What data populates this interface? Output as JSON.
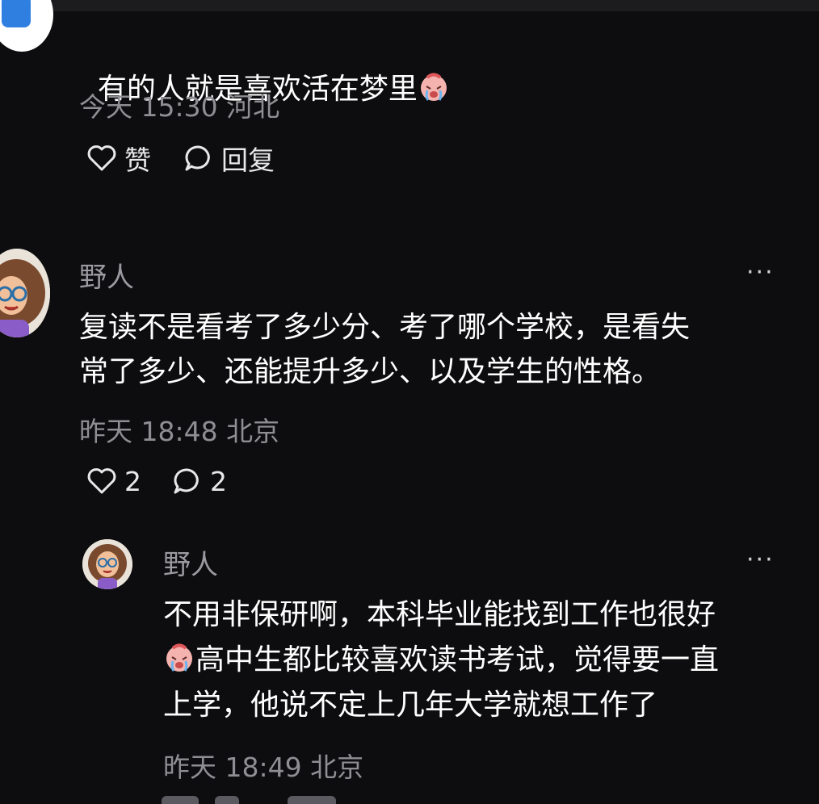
{
  "comment1": {
    "text": "有的人就是喜欢活在梦里",
    "emoji": "crying-face-emoji",
    "time_location": "今天 15:30 河北",
    "like_label": "赞",
    "reply_label": "回复"
  },
  "comment2": {
    "username": "野人",
    "text": "复读不是看考了多少分、考了哪个学校，是看失\n常了多少、还能提升多少、以及学生的性格。",
    "time_location": "昨天 18:48 北京",
    "like_count": "2",
    "reply_count": "2",
    "more_label": "···"
  },
  "reply1": {
    "username": "野人",
    "text_line1": "不用非保研啊，本科毕业能找到工作也很好",
    "text_line2": "高中生都比较喜欢读书考试，觉得要一直",
    "text_line3": "上学，他说不定上几年大学就想工作了",
    "emoji": "crying-face-emoji",
    "time_location": "昨天 18:49 北京",
    "more_label": "···"
  },
  "colors": {
    "background": "#0d0d0f",
    "text": "#ffffff",
    "meta": "#8e8e93"
  }
}
